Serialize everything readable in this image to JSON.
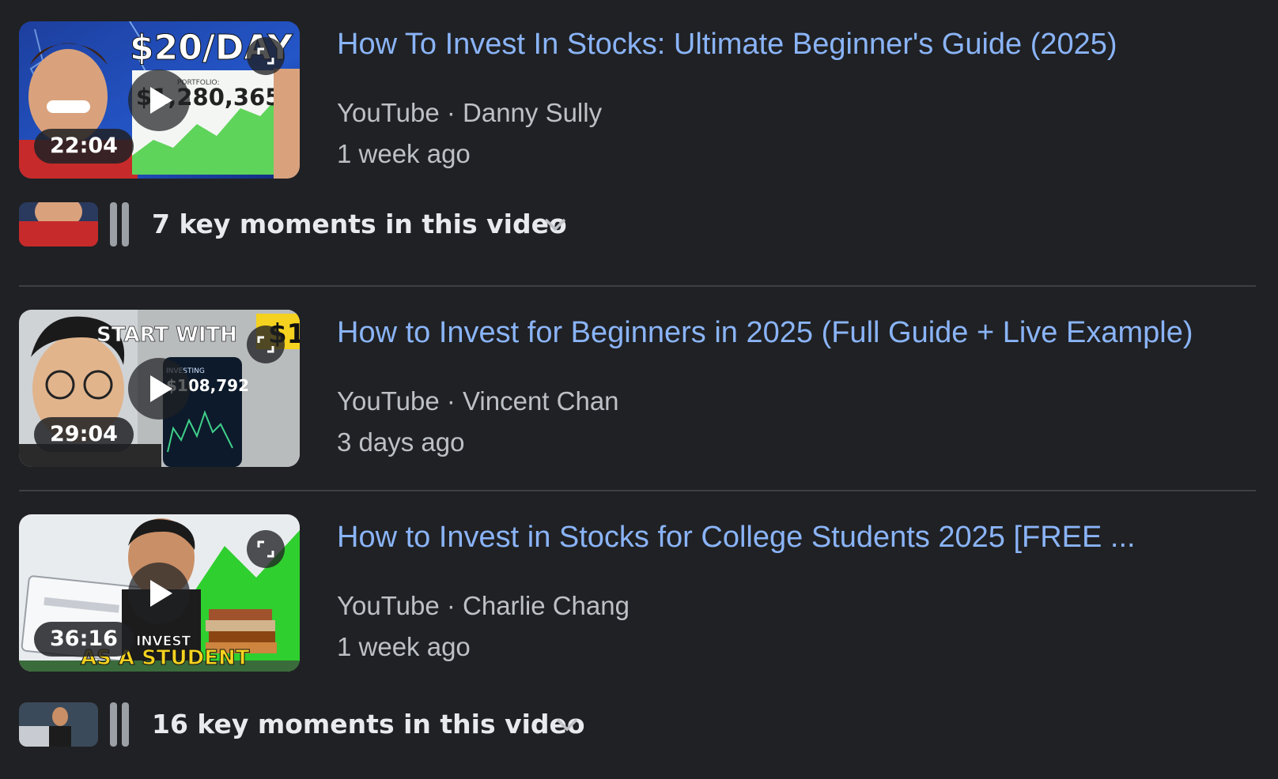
{
  "results": [
    {
      "title": "How To Invest In Stocks: Ultimate Beginner's Guide (2025)",
      "source": "YouTube · Danny Sully",
      "age": "1 week ago",
      "duration": "22:04",
      "thumbnail_text": [
        "$20/DAY",
        "PORTFOLIO:",
        "$1,280,365"
      ],
      "key_moments": "7 key moments in this video"
    },
    {
      "title": "How to Invest for Beginners in 2025 (Full Guide + Live Example)",
      "source": "YouTube · Vincent Chan",
      "age": "3 days ago",
      "duration": "29:04",
      "thumbnail_text": [
        "START WITH",
        "$1",
        "INVESTING",
        "$108,792"
      ]
    },
    {
      "title": "How to Invest in Stocks for College Students 2025 [FREE ...",
      "source": "YouTube · Charlie Chang",
      "age": "1 week ago",
      "duration": "36:16",
      "thumbnail_text": [
        "INVEST",
        "AS A STUDENT"
      ],
      "key_moments": "16 key moments in this video"
    }
  ],
  "colors": {
    "background": "#202124",
    "link": "#8ab4f8",
    "meta": "#bdc1c6",
    "divider": "#3c4043"
  },
  "icons": [
    "play-icon",
    "expand-icon",
    "chevron-down-icon"
  ]
}
